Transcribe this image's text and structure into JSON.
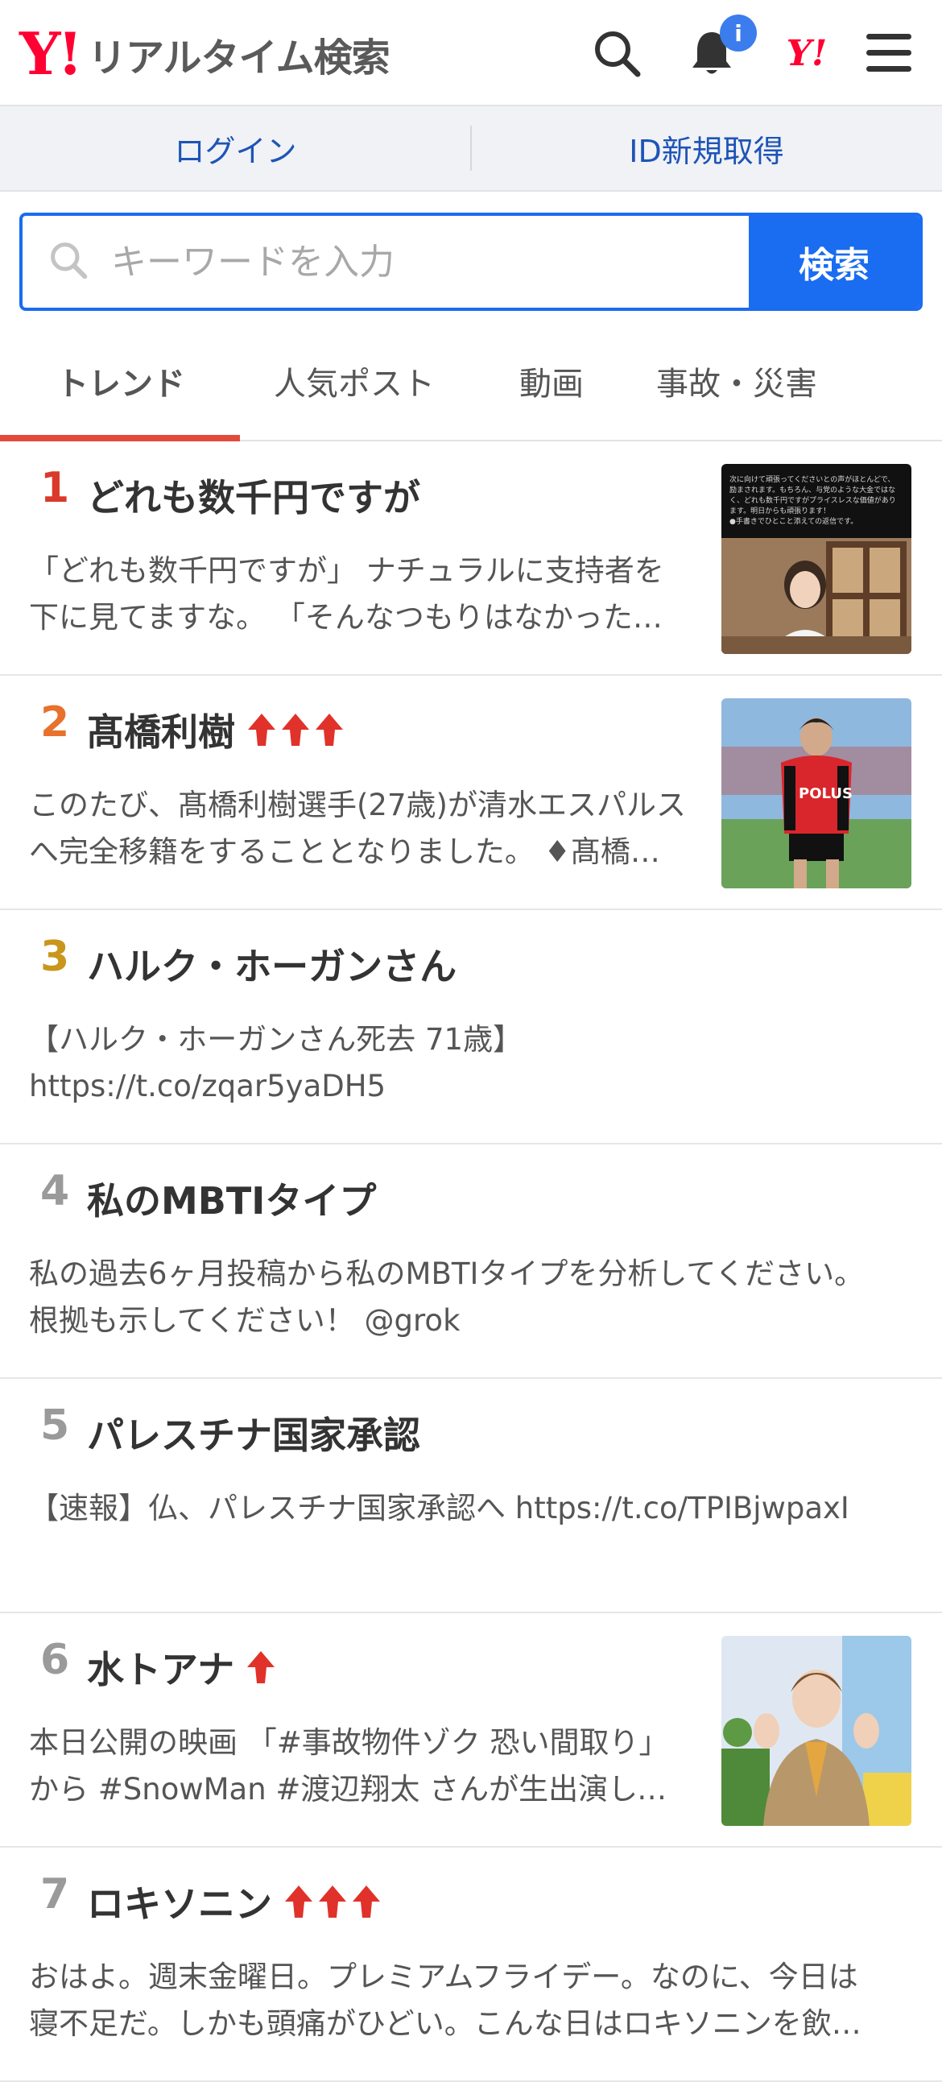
{
  "header": {
    "logo_y": "Y!",
    "title": "リアルタイム検索",
    "icons": [
      "search-icon",
      "bell-icon",
      "yahoo-logo-icon",
      "menu-icon"
    ],
    "notification_badge": "i"
  },
  "login_bar": {
    "login": "ログイン",
    "register": "ID新規取得"
  },
  "search": {
    "placeholder": "キーワードを入力",
    "button": "検索"
  },
  "tabs": [
    {
      "label": "トレンド",
      "active": true
    },
    {
      "label": "人気ポスト",
      "active": false
    },
    {
      "label": "動画",
      "active": false
    },
    {
      "label": "事故・災害",
      "active": false
    }
  ],
  "colors": {
    "yahoo_red": "#ff0033",
    "accent_blue": "#1a6cf0",
    "link_blue": "#1e54b7",
    "tab_underline": "#e24b3b",
    "rank1": "#d93a2b",
    "rank2": "#e8712d",
    "rank3": "#c8961b",
    "rank_other": "#9a9a9a",
    "up_arrow": "#e0322a"
  },
  "trends": [
    {
      "rank": "1",
      "title": "どれも数千円ですが",
      "arrows": 0,
      "has_thumb": true,
      "desc": "「どれも数千円ですが」 ナチュラルに支持者を下に見てますな。 「そんなつもりはなかったのですが」"
    },
    {
      "rank": "2",
      "title": "髙橋利樹",
      "arrows": 3,
      "has_thumb": true,
      "desc": "このたび、髙橋利樹選手(27歳)が清水エスパルスへ完全移籍をすることとなりました。 ♦髙橋利樹選手コメント"
    },
    {
      "rank": "3",
      "title": "ハルク・ホーガンさん",
      "arrows": 0,
      "has_thumb": false,
      "desc": "【ハルク・ホーガンさん死去 71歳】 https://t.co/zqar5yaDH5"
    },
    {
      "rank": "4",
      "title": "私のMBTIタイプ",
      "arrows": 0,
      "has_thumb": false,
      "desc": "私の過去6ヶ月投稿から私のMBTIタイプを分析してください。根拠も示してください！ @grok"
    },
    {
      "rank": "5",
      "title": "パレスチナ国家承認",
      "arrows": 0,
      "has_thumb": false,
      "desc": "【速報】仏、パレスチナ国家承認へ https://t.co/TPIBjwpaxI"
    },
    {
      "rank": "6",
      "title": "水トアナ",
      "arrows": 1,
      "has_thumb": true,
      "desc": "本日公開の映画 「#事故物件ゾク 恐い間取り」から #SnowMan #渡辺翔太 さんが生出演してくれました"
    },
    {
      "rank": "7",
      "title": "ロキソニン",
      "arrows": 3,
      "has_thumb": false,
      "desc": "おはよ。週末金曜日。プレミアムフライデー。なのに、今日は寝不足だ。しかも頭痛がひどい。こんな日はロキソニンを飲んで"
    }
  ],
  "thumbs": {
    "1": {
      "caption_lines": [
        "次に向けて頑張ってくださいとの声がほとんどで、",
        "励まされます。もちろん、与党のような大金ではな",
        "く、どれも数千円ですがプライスレスな価値があり",
        "ます。明日からも頑張ります！",
        "●手書きでひとこと添えての返信です。"
      ]
    },
    "2": {
      "jersey_text": "POLUS"
    }
  }
}
